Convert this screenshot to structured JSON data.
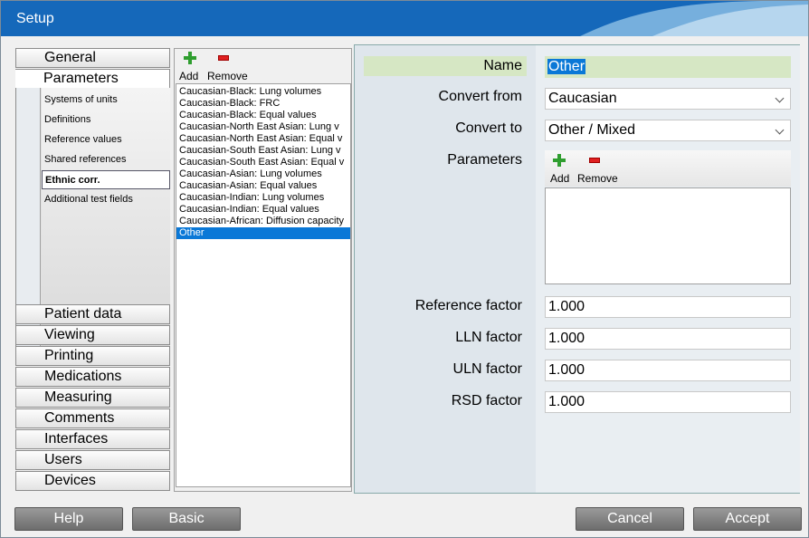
{
  "window": {
    "title": "Setup"
  },
  "nav": {
    "items": [
      "General",
      "Parameters"
    ],
    "sub_items": [
      "Systems of units",
      "Definitions",
      "Reference values",
      "Shared references",
      "Ethnic corr.",
      "Additional test fields"
    ],
    "selected_sub": "Ethnic corr.",
    "items_bottom": [
      "Patient data",
      "Viewing",
      "Printing",
      "Medications",
      "Measuring",
      "Comments",
      "Interfaces",
      "Users",
      "Devices"
    ]
  },
  "list_toolbar": {
    "add": "Add",
    "remove": "Remove"
  },
  "list": {
    "items": [
      "Caucasian-Black: Lung volumes",
      "Caucasian-Black: FRC",
      "Caucasian-Black: Equal values",
      "Caucasian-North East Asian: Lung v",
      "Caucasian-North East Asian: Equal v",
      "Caucasian-South East Asian: Lung v",
      "Caucasian-South East Asian: Equal v",
      "Caucasian-Asian: Lung volumes",
      "Caucasian-Asian: Equal values",
      "Caucasian-Indian: Lung volumes",
      "Caucasian-Indian: Equal values",
      "Caucasian-African: Diffusion capacity",
      "Other"
    ],
    "selected": "Other"
  },
  "detail": {
    "name_label": "Name",
    "name_value": "Other",
    "convert_from_label": "Convert from",
    "convert_from_value": "Caucasian",
    "convert_to_label": "Convert to",
    "convert_to_value": "Other / Mixed",
    "parameters_label": "Parameters",
    "param_add": "Add",
    "param_remove": "Remove",
    "reference_factor_label": "Reference factor",
    "reference_factor_value": "1.000",
    "lln_factor_label": "LLN factor",
    "lln_factor_value": "1.000",
    "uln_factor_label": "ULN factor",
    "uln_factor_value": "1.000",
    "rsd_factor_label": "RSD factor",
    "rsd_factor_value": "1.000"
  },
  "buttons": {
    "help": "Help",
    "basic": "Basic",
    "cancel": "Cancel",
    "accept": "Accept"
  },
  "colors": {
    "titlebar": "#1568ba",
    "selection": "#0a78d7",
    "name_highlight": "#d6e7c4"
  }
}
